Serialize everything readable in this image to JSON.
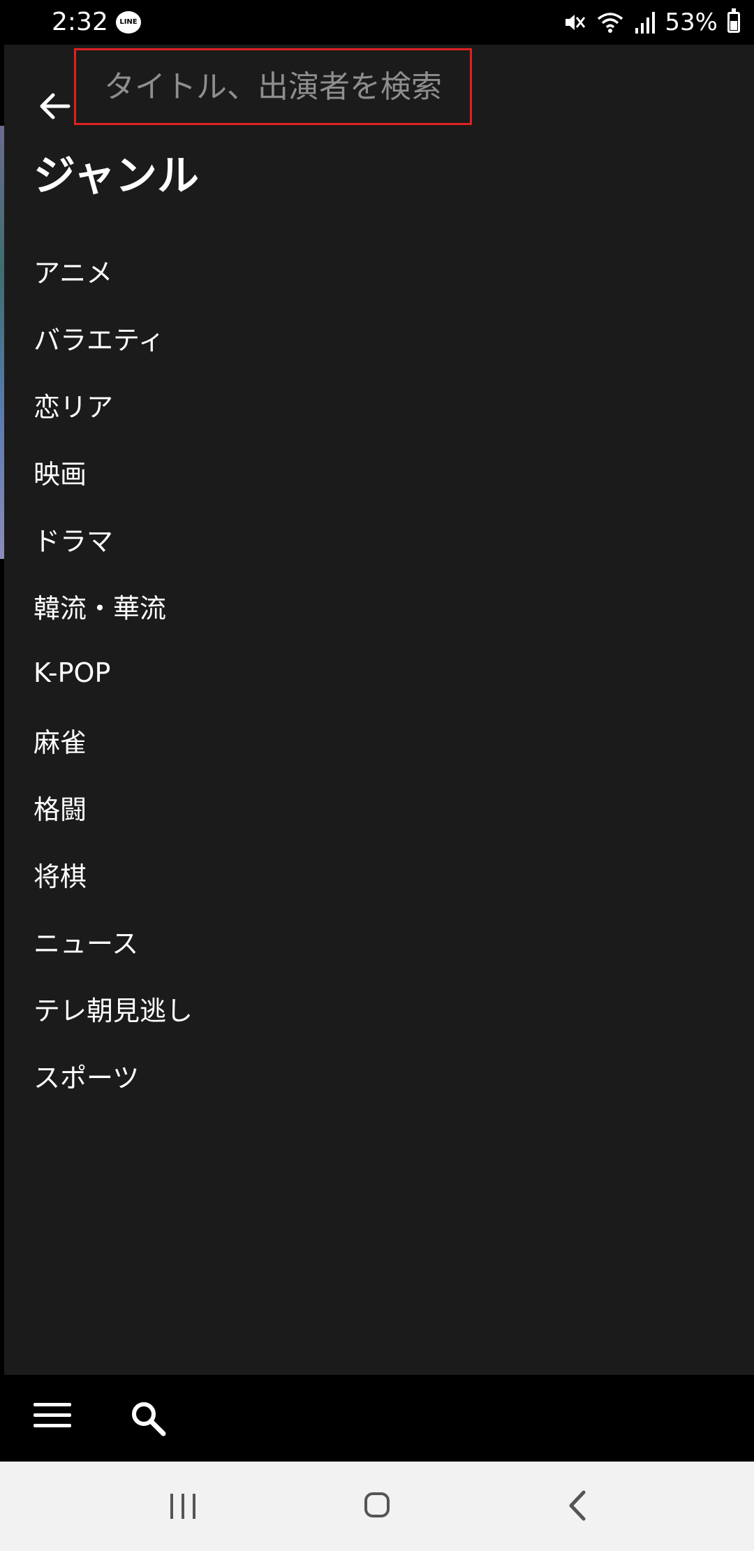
{
  "status": {
    "time": "2:32",
    "line_label": "LINE",
    "battery_pct": "53%",
    "battery_level": 0.53
  },
  "search": {
    "placeholder": "タイトル、出演者を検索",
    "highlight_color": "#e02020"
  },
  "genre": {
    "title": "ジャンル",
    "items": [
      {
        "label": "アニメ"
      },
      {
        "label": "バラエティ"
      },
      {
        "label": "恋リア"
      },
      {
        "label": "映画"
      },
      {
        "label": "ドラマ"
      },
      {
        "label": "韓流・華流"
      },
      {
        "label": "K-POP"
      },
      {
        "label": "麻雀"
      },
      {
        "label": "格闘"
      },
      {
        "label": "将棋"
      },
      {
        "label": "ニュース"
      },
      {
        "label": "テレ朝見逃し"
      },
      {
        "label": "スポーツ"
      }
    ]
  },
  "icons": {
    "back": "arrow-left-icon",
    "menu": "hamburger-menu-icon",
    "search": "search-icon",
    "recents": "recents-icon",
    "home": "home-icon",
    "nav_back": "chevron-left-icon"
  },
  "colors": {
    "panel_bg": "#1b1b1b",
    "app_bar_bg": "#000000",
    "nav_bar_bg": "#f2f2f2"
  }
}
